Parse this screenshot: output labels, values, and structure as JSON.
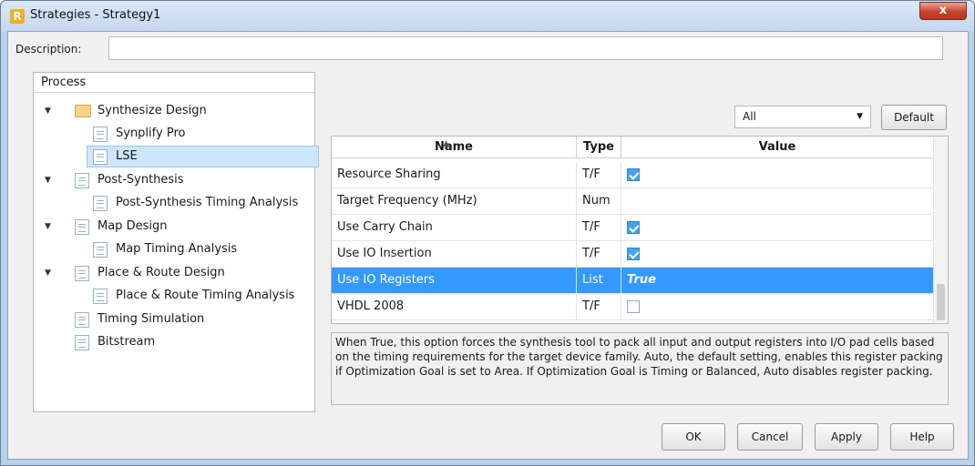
{
  "window": {
    "title": "Strategies - Strategy1",
    "app_icon_letter": "R",
    "close_glyph": "x"
  },
  "description": {
    "label": "Description:",
    "value": ""
  },
  "tree": {
    "header": "Process",
    "items": [
      {
        "label": "Synthesize Design",
        "icon": "folder-icon",
        "expanded": true
      },
      {
        "label": "Synplify Pro",
        "icon": "document-icon"
      },
      {
        "label": "LSE",
        "icon": "document-icon",
        "selected": true
      },
      {
        "label": "Post-Synthesis",
        "icon": "document-icon",
        "expanded": true
      },
      {
        "label": "Post-Synthesis Timing Analysis",
        "icon": "document-icon"
      },
      {
        "label": "Map Design",
        "icon": "document-icon",
        "expanded": true
      },
      {
        "label": "Map Timing Analysis",
        "icon": "document-icon"
      },
      {
        "label": "Place & Route Design",
        "icon": "document-icon",
        "expanded": true
      },
      {
        "label": "Place & Route Timing Analysis",
        "icon": "document-icon"
      },
      {
        "label": "Timing Simulation",
        "icon": "document-icon"
      },
      {
        "label": "Bitstream",
        "icon": "document-icon"
      }
    ]
  },
  "filter": {
    "selected": "All",
    "default_button": "Default"
  },
  "table": {
    "columns": [
      "Name",
      "Type",
      "Value"
    ],
    "rows": [
      {
        "name": "Resource Sharing",
        "type": "T/F",
        "value": "checked"
      },
      {
        "name": "Target Frequency (MHz)",
        "type": "Num",
        "value": ""
      },
      {
        "name": "Use Carry Chain",
        "type": "T/F",
        "value": "checked"
      },
      {
        "name": "Use IO Insertion",
        "type": "T/F",
        "value": "checked"
      },
      {
        "name": "Use IO Registers",
        "type": "List",
        "value": "True",
        "selected": true
      },
      {
        "name": "VHDL 2008",
        "type": "T/F",
        "value": "unchecked"
      }
    ]
  },
  "info_text": "When True, this option forces the synthesis tool to pack all input and output registers into I/O pad cells based on the timing requirements for the target device family. Auto, the default setting, enables this register packing if Optimization Goal is set to Area. If Optimization Goal is Timing or Balanced, Auto disables register packing.",
  "buttons": {
    "ok": "OK",
    "cancel": "Cancel",
    "apply": "Apply",
    "help": "Help"
  },
  "colors": {
    "selection": "#3399ff",
    "tree_selection": "#cde6fa",
    "checkbox_checked": "#49a3e8"
  }
}
